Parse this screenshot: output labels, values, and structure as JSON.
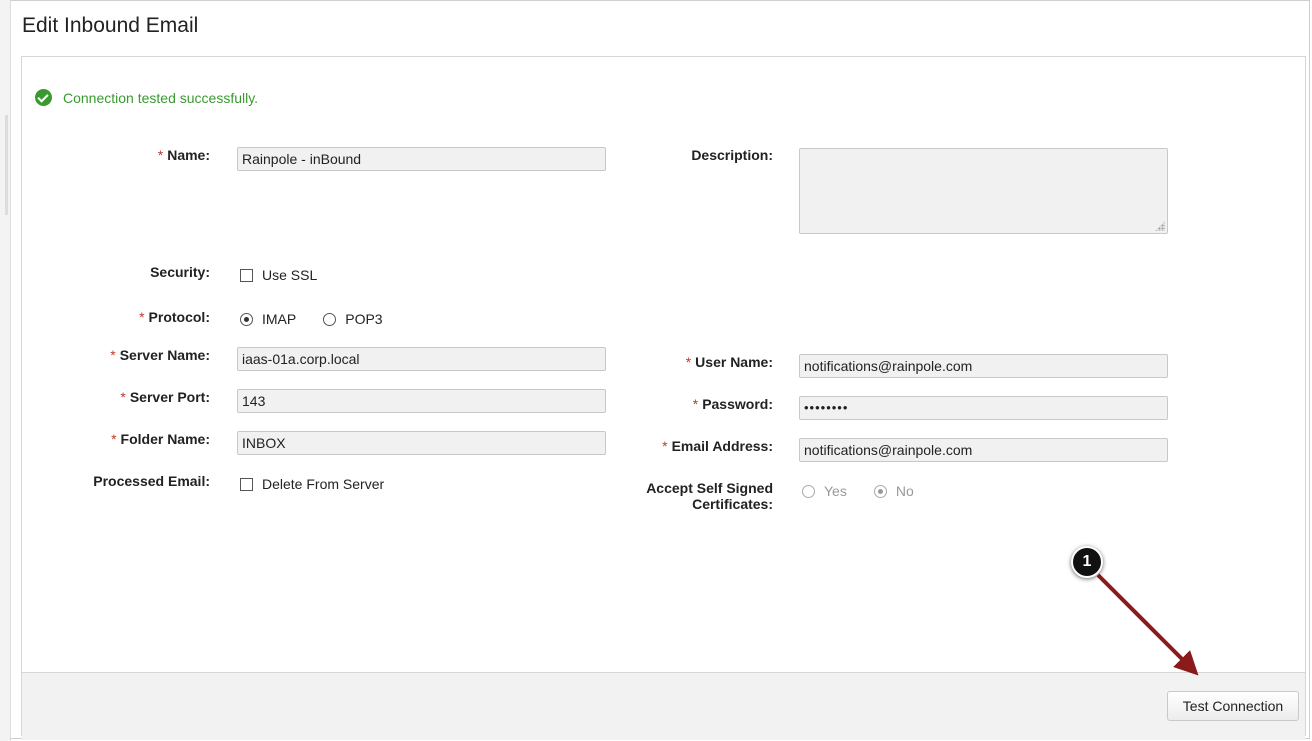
{
  "page": {
    "title": "Edit Inbound Email",
    "success_message": "Connection tested successfully."
  },
  "fields": {
    "name": {
      "label": "Name:",
      "required": "*",
      "value": "Rainpole - inBound"
    },
    "description": {
      "label": "Description:",
      "value": ""
    },
    "security": {
      "label": "Security:",
      "option": "Use SSL",
      "checked": false
    },
    "protocol": {
      "label": "Protocol:",
      "required": "*",
      "options": [
        "IMAP",
        "POP3"
      ],
      "selected": "IMAP"
    },
    "server_name": {
      "label": "Server Name:",
      "required": "*",
      "value": "iaas-01a.corp.local"
    },
    "server_port": {
      "label": "Server Port:",
      "required": "*",
      "value": "143"
    },
    "folder_name": {
      "label": "Folder Name:",
      "required": "*",
      "value": "INBOX"
    },
    "processed_email": {
      "label": "Processed Email:",
      "option": "Delete From Server",
      "checked": false
    },
    "user_name": {
      "label": "User Name:",
      "required": "*",
      "value": "notifications@rainpole.com"
    },
    "password": {
      "label": "Password:",
      "required": "*",
      "value": "••••••••"
    },
    "email_address": {
      "label": "Email Address:",
      "required": "*",
      "value": "notifications@rainpole.com"
    },
    "accept_self_signed": {
      "label_line1": "Accept Self Signed",
      "label_line2": "Certificates:",
      "options": [
        "Yes",
        "No"
      ],
      "selected": "No"
    }
  },
  "footer": {
    "test_connection_label": "Test Connection"
  },
  "annotation": {
    "step_number": "1"
  },
  "colors": {
    "success": "#3a9a2f",
    "required": "#c0392b",
    "arrow": "#8b1a1a"
  }
}
